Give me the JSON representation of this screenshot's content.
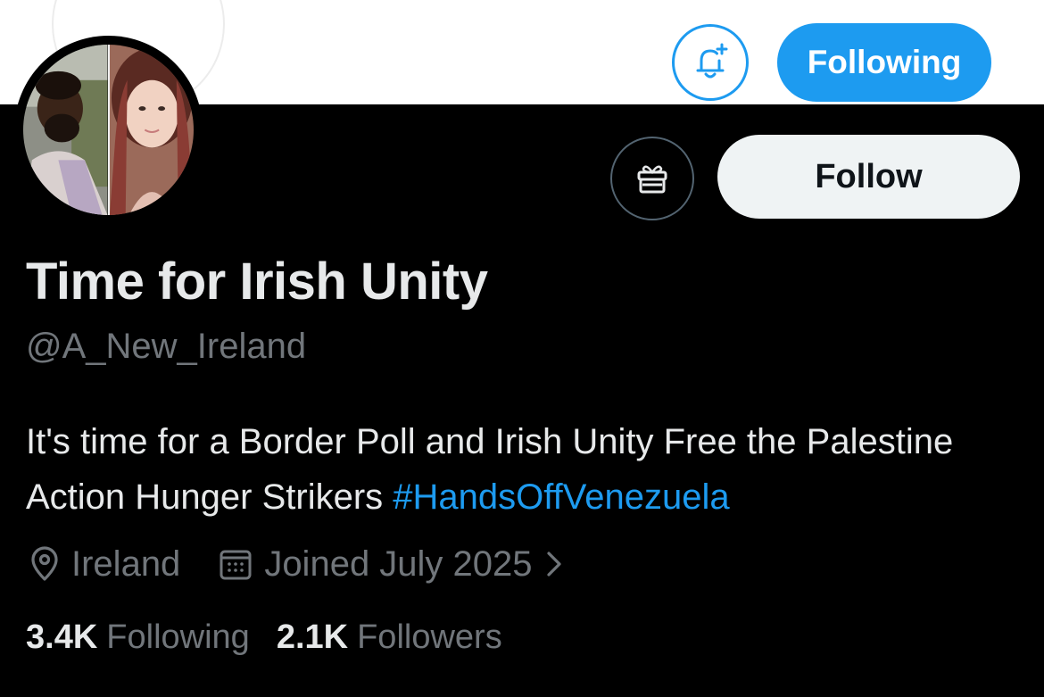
{
  "header": {
    "following_button_label": "Following"
  },
  "profile": {
    "display_name": "Time for Irish Unity",
    "handle": "@A_New_Ireland",
    "bio_text": "It's time for a Border Poll and Irish Unity Free the Palestine Action Hunger Strikers",
    "bio_hashtag": "#HandsOffVenezuela",
    "location": "Ireland",
    "joined": "Joined July 2025",
    "follow_button_label": "Follow"
  },
  "stats": {
    "following_count": "3.4K",
    "following_label": "Following",
    "followers_count": "2.1K",
    "followers_label": "Followers"
  },
  "colors": {
    "accent": "#1d9bf0",
    "background": "#000000",
    "primary_text": "#e7e9ea",
    "secondary_text": "#71767b"
  },
  "icons": [
    "bell-plus-icon",
    "gift-icon",
    "location-pin-icon",
    "calendar-icon",
    "chevron-right-icon"
  ]
}
